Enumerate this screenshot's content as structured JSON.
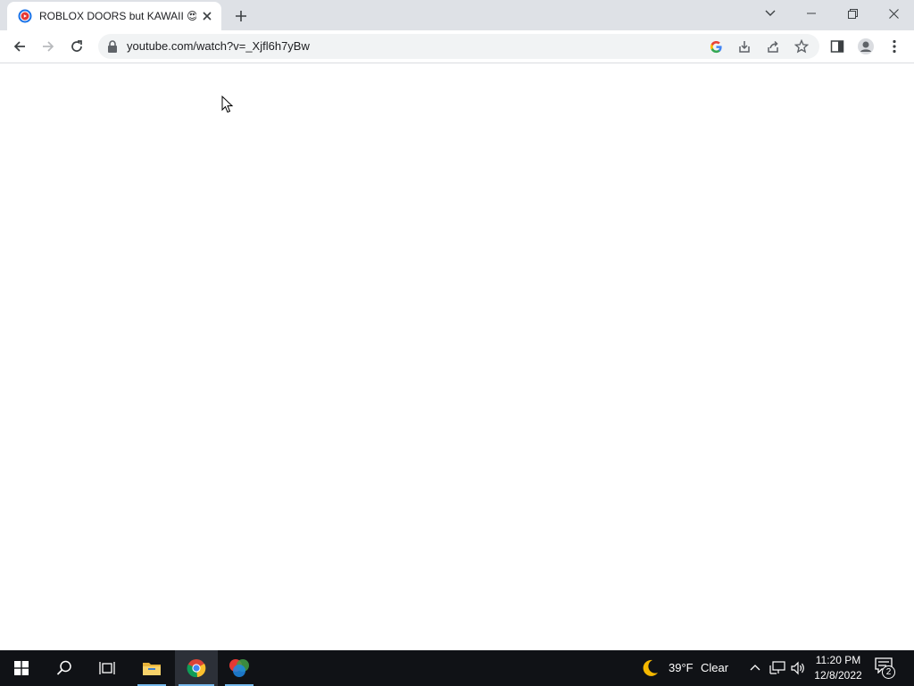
{
  "browser": {
    "tab": {
      "title": "ROBLOX DOORS but KAWAII 😍😍",
      "favicon": "youtube-loading-favicon"
    },
    "toolbar": {
      "url": "youtube.com/watch?v=_Xjfl6h7yBw",
      "icons": [
        "back-icon",
        "forward-icon",
        "reload-icon",
        "lock-icon",
        "google-icon",
        "install-icon",
        "share-icon",
        "bookmark-star-icon",
        "side-panel-icon",
        "profile-icon",
        "menu-icon"
      ]
    },
    "window_controls": [
      "tab-search-icon",
      "minimize-icon",
      "restore-icon",
      "close-icon"
    ],
    "colors": {
      "titlebar": "#dee1e6",
      "omnibox": "#f1f3f4",
      "taskbar": "#101216",
      "accent": "#76b9ed"
    }
  },
  "taskbar": {
    "apps": [
      "windows-start-icon",
      "search-icon",
      "task-view-icon",
      "file-explorer-icon",
      "chrome-icon",
      "paint-app-icon"
    ],
    "weather": {
      "temp": "39°F",
      "condition": "Clear",
      "icon": "moon-icon"
    },
    "clock": {
      "time": "11:20 PM",
      "date": "12/8/2022"
    },
    "notifications": {
      "count": "2"
    }
  }
}
